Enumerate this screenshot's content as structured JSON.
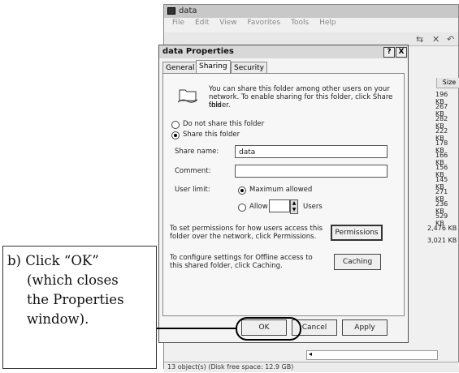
{
  "explorer": {
    "title": "data",
    "menu": [
      "File",
      "Edit",
      "View",
      "Favorites",
      "Tools",
      "Help"
    ],
    "size_header": "Size",
    "sizes": [
      "196 KB",
      "267 KB",
      "282 KB",
      "222 KB",
      "178 KB",
      "166 KB",
      "156 KB",
      "145 KB",
      "271 KB",
      "236 KB",
      "529 KB",
      "2,476 KB",
      "3,021 KB"
    ],
    "status": "13 object(s) (Disk free space: 12.9 GB)"
  },
  "dialog": {
    "title": "data Properties",
    "help_btn": "?",
    "close_btn": "X",
    "tabs": [
      "General",
      "Sharing",
      "Security"
    ],
    "active_tab": "Sharing",
    "intro_lines": [
      "You can share this folder among other users on your",
      "network.  To enable sharing for this folder, click Share this",
      "folder."
    ],
    "do_not_share": "Do not share this folder",
    "share_this": "Share this folder",
    "share_name_label": "Share name:",
    "share_name_value": "data",
    "comment_label": "Comment:",
    "comment_value": "",
    "user_limit_label": "User limit:",
    "max_allowed": "Maximum allowed",
    "allow": "Allow",
    "users": "Users",
    "perm_lines": [
      "To set permissions for how users access this",
      "folder over the network, click Permissions."
    ],
    "permissions_btn": "Permissions",
    "cache_lines": [
      "To configure settings for Offline access to",
      "this shared folder, click Caching."
    ],
    "caching_btn": "Caching",
    "ok": "OK",
    "cancel": "Cancel",
    "apply": "Apply"
  },
  "callout": {
    "lines": [
      "b) Click “OK”",
      "(which closes",
      "the Properties",
      "window)."
    ]
  }
}
